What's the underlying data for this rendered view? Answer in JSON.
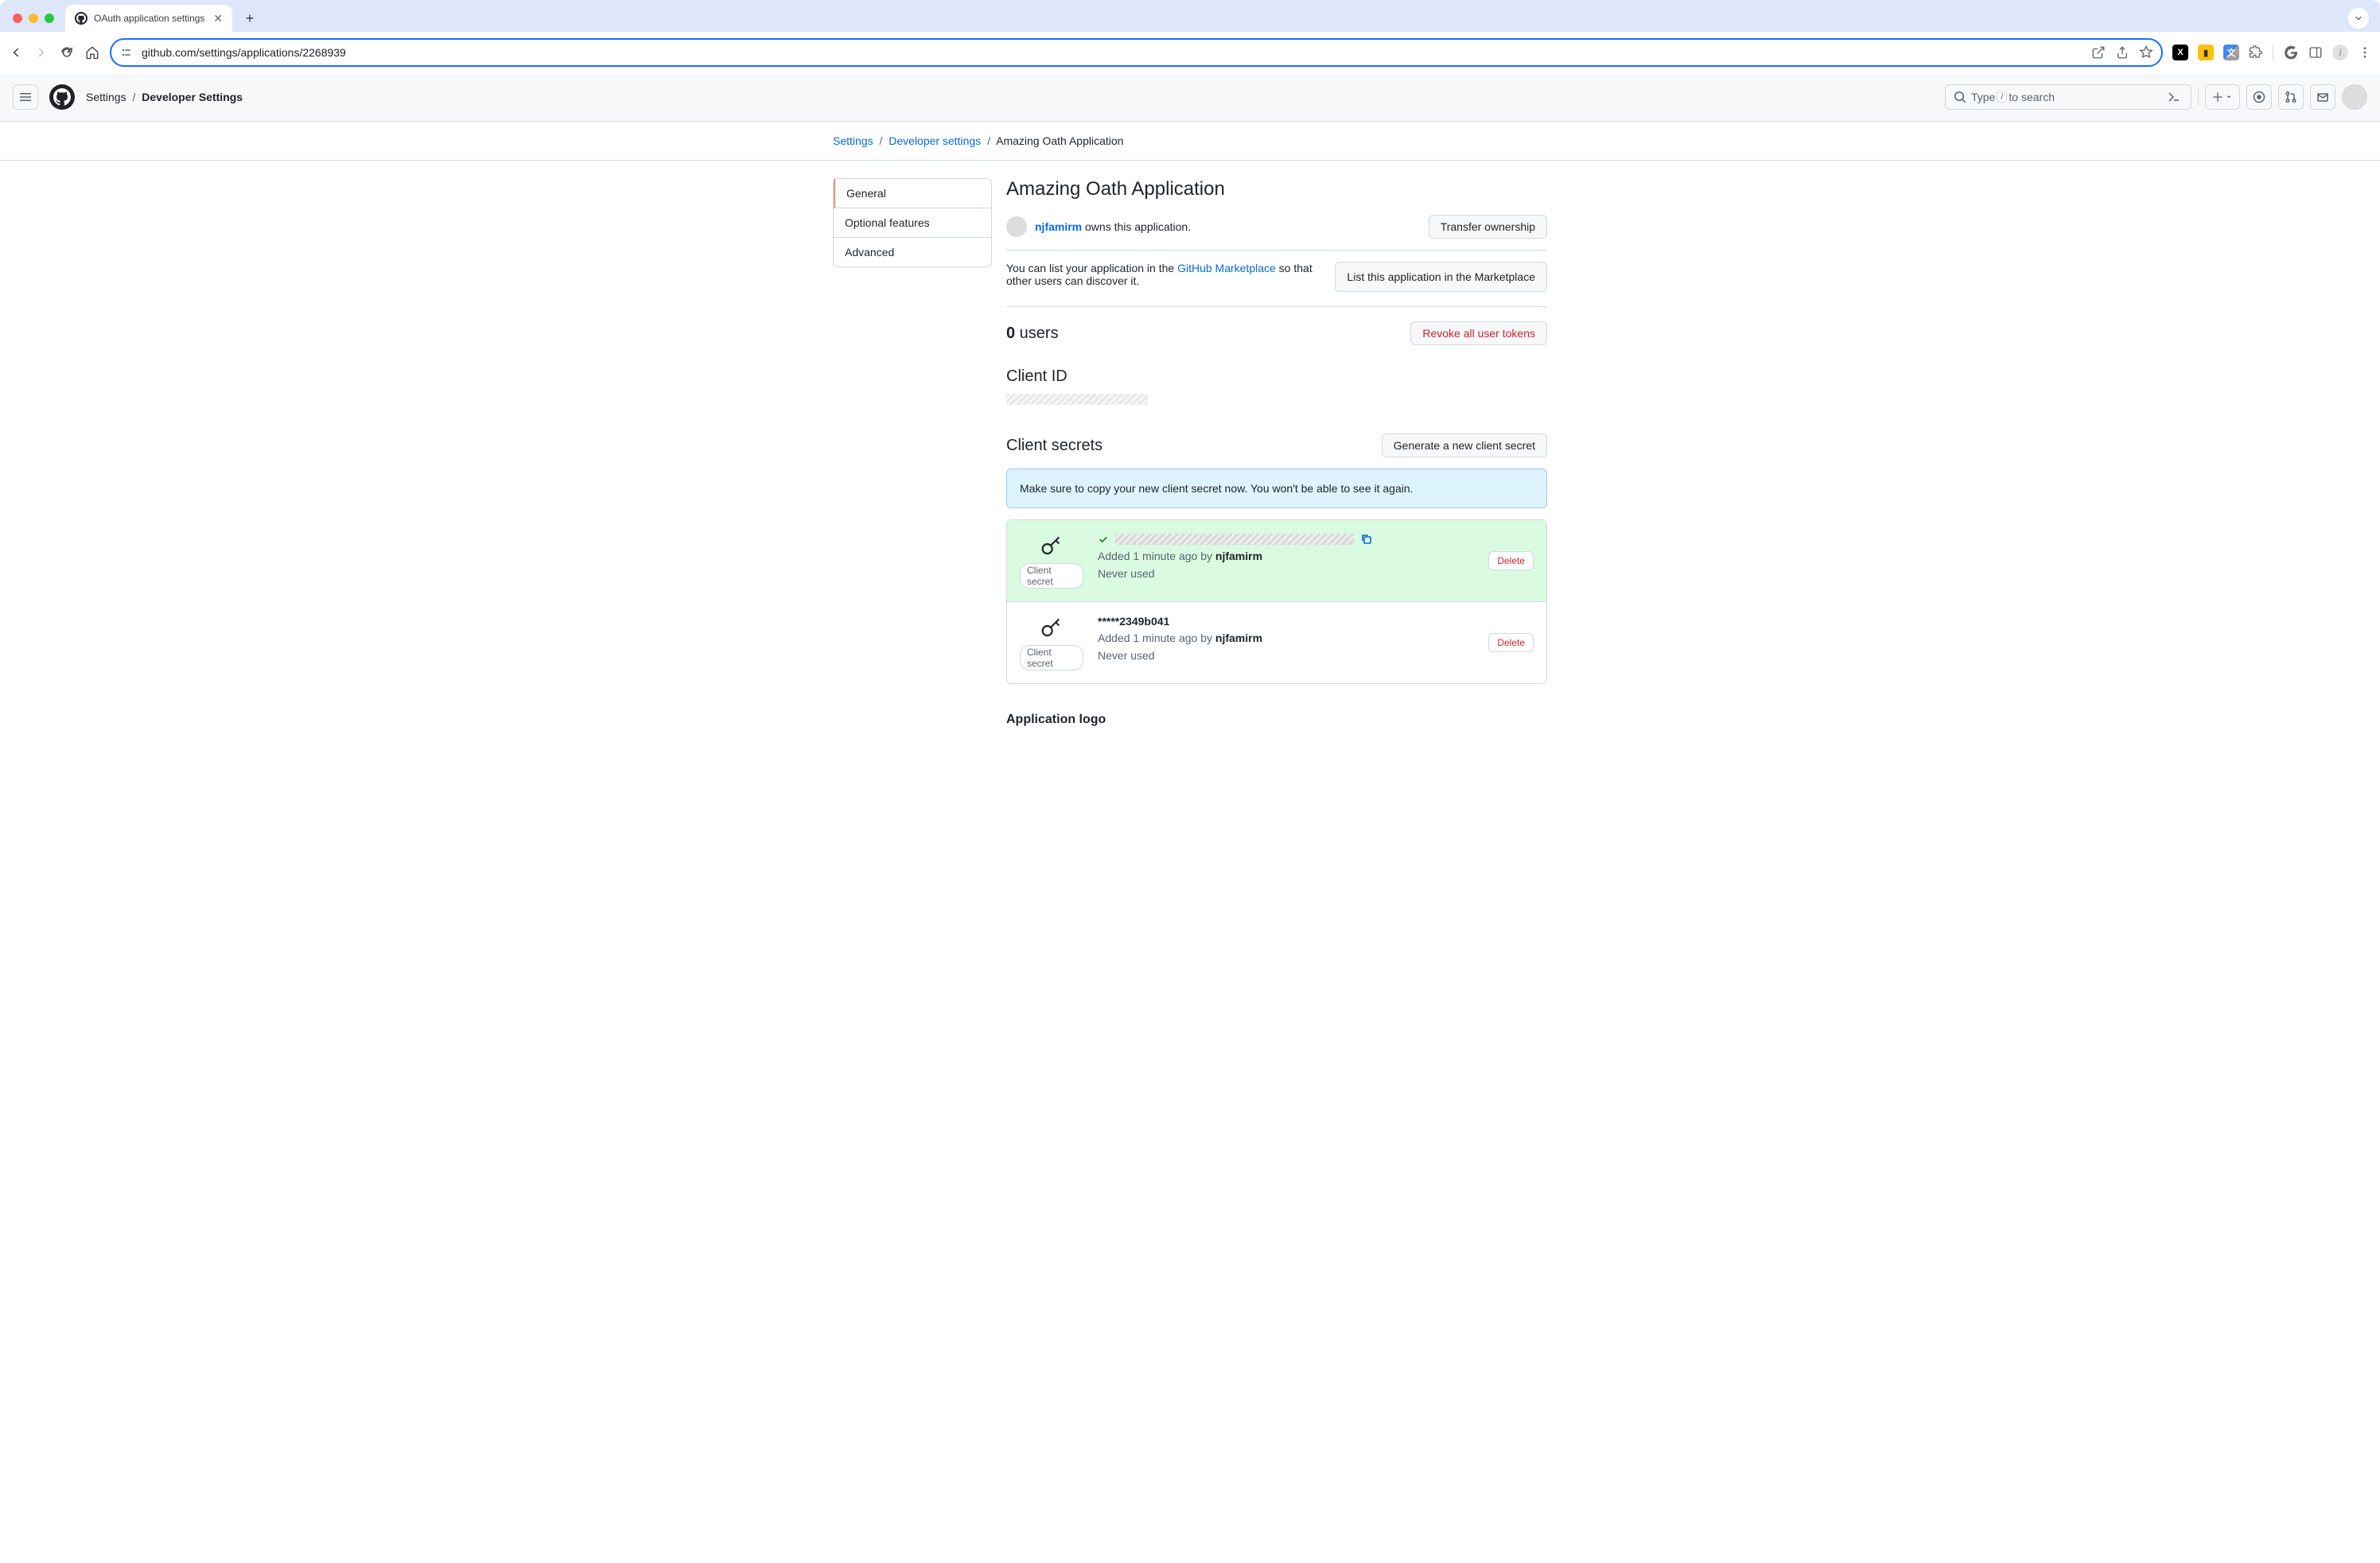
{
  "browser": {
    "tab_title": "OAuth application settings",
    "url": "github.com/settings/applications/2268939"
  },
  "gh_header": {
    "bc1": "Settings",
    "bc2": "Developer Settings",
    "search_pre": "Type",
    "search_key": "/",
    "search_post": "to search"
  },
  "breadcrumb": {
    "settings": "Settings",
    "developer": "Developer settings",
    "current": "Amazing Oath Application"
  },
  "sidenav": {
    "general": "General",
    "optional": "Optional features",
    "advanced": "Advanced"
  },
  "app": {
    "title": "Amazing Oath Application",
    "owner_user": "njfamirm",
    "owner_suffix": " owns this application.",
    "transfer_btn": "Transfer ownership",
    "marketplace_pre": "You can list your application in the ",
    "marketplace_link": "GitHub Marketplace",
    "marketplace_post": " so that other users can discover it.",
    "list_btn": "List this application in the Marketplace",
    "users_count": "0",
    "users_label": " users",
    "revoke_btn": "Revoke all user tokens",
    "client_id_heading": "Client ID",
    "secrets_heading": "Client secrets",
    "generate_btn": "Generate a new client secret",
    "flash": "Make sure to copy your new client secret now. You won't be able to see it again.",
    "secret_label": "Client secret",
    "added_pre": "Added 1 minute ago by ",
    "added_user": "njfamirm",
    "never_used": "Never used",
    "delete": "Delete",
    "secret2_val": "*****2349b041",
    "logo_heading": "Application logo"
  }
}
